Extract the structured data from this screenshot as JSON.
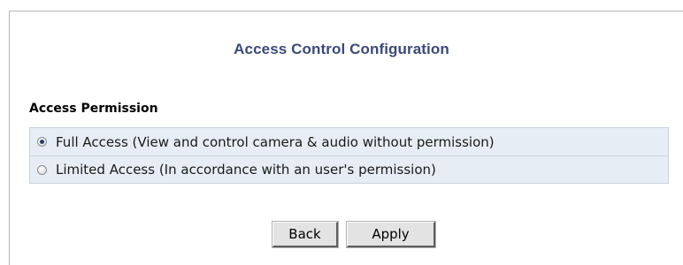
{
  "header": {
    "title": "Access Control Configuration"
  },
  "access_permission": {
    "label": "Access Permission",
    "options": [
      {
        "label": "Full Access (View and control camera & audio without permission)",
        "selected": true
      },
      {
        "label": "Limited Access (In accordance with an user's permission)",
        "selected": false
      }
    ]
  },
  "actions": {
    "back_label": "Back",
    "apply_label": "Apply"
  },
  "colors": {
    "title": "#3a4a78",
    "option_background": "#e6edf4",
    "option_border": "#c9d3de",
    "frame_border": "#b5b5b5"
  }
}
